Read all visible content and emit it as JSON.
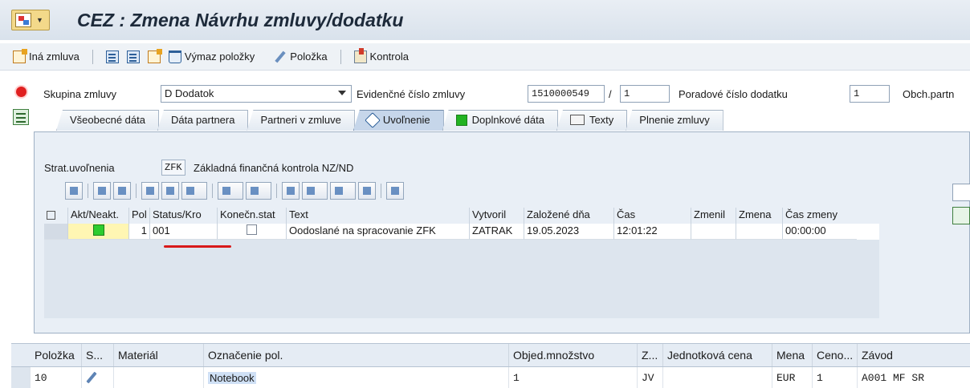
{
  "window": {
    "title": "CEZ : Zmena Návrhu zmluvy/dodatku"
  },
  "toolbar": {
    "items": [
      {
        "label": "Iná zmluva",
        "icon": "new-document-icon"
      },
      {
        "label": "Výmaz položky",
        "icon": "trash-icon"
      },
      {
        "label": "Položka",
        "icon": "pencil-icon"
      },
      {
        "label": "Kontrola",
        "icon": "check-icon"
      }
    ]
  },
  "header": {
    "skupina_label": "Skupina zmluvy",
    "skupina_value": "D Dodatok",
    "evid_label": "Evidenčné číslo zmluvy",
    "evid_value": "1510000549",
    "evid_sep": "/",
    "evid_sub": "1",
    "poradove_label": "Poradové číslo dodatku",
    "poradove_value": "1",
    "obch_label": "Obch.partn"
  },
  "tabs": [
    {
      "label": "Všeobecné dáta"
    },
    {
      "label": "Dáta partnera"
    },
    {
      "label": "Partneri v zmluve"
    },
    {
      "label": "Uvoľnenie",
      "active": true
    },
    {
      "label": "Doplnkové dáta"
    },
    {
      "label": "Texty"
    },
    {
      "label": "Plnenie zmluvy"
    }
  ],
  "release": {
    "strat_label": "Strat.uvoľnenia",
    "strat_code": "ZFK",
    "strat_desc": "Základná finančná kontrola NZ/ND",
    "columns": [
      "Akt/Neakt.",
      "Pol",
      "Status/Kro",
      "Konečn.stat",
      "Text",
      "Vytvoril",
      "Založené dňa",
      "Čas",
      "Zmenil",
      "Zmena",
      "Čas zmeny"
    ],
    "rows": [
      {
        "pol": "1",
        "status": "001",
        "text": "Oodoslané na spracovanie ZFK",
        "vytvoril": "ZATRAK",
        "zalozene": "19.05.2023",
        "cas": "12:01:22",
        "zmenil": "",
        "zmena": "",
        "cas_zmeny": "00:00:00"
      }
    ]
  },
  "items": {
    "columns": [
      "Položka",
      "S...",
      "Materiál",
      "Označenie pol.",
      "Objed.množstvo",
      "Z...",
      "Jednotková cena",
      "Mena",
      "Ceno...",
      "Závod"
    ],
    "rows": [
      {
        "polozka": "10",
        "material": "",
        "oznacenie": "Notebook",
        "mnozstvo": "1",
        "z": "JV",
        "cena": "",
        "mena": "EUR",
        "ceno": "1",
        "zavod": "A001 MF SR"
      }
    ]
  }
}
